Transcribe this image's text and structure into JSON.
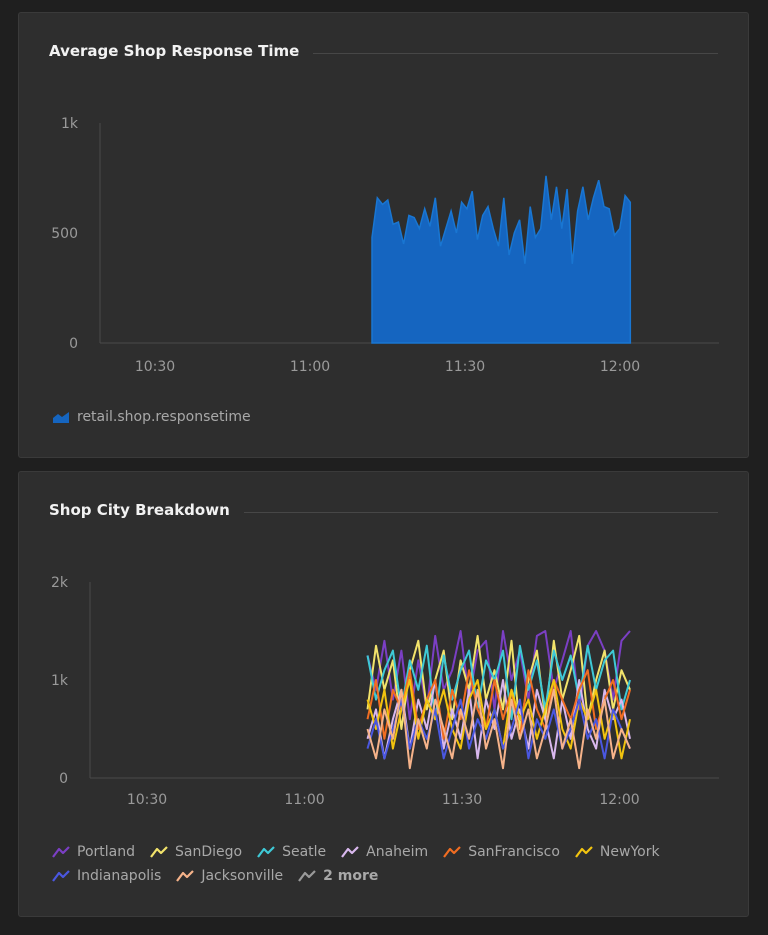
{
  "chart_data": [
    {
      "type": "area",
      "title": "Average Shop Response Time",
      "x_ticks": [
        "10:30",
        "11:00",
        "11:30",
        "12:00"
      ],
      "y_ticks": [
        "0",
        "500",
        "1k"
      ],
      "ylim": [
        0,
        1000
      ],
      "grid": false,
      "legend_placement": "bottom-left",
      "series": [
        {
          "name": "retail.shop.responsetime",
          "color": "#1565c0",
          "x_start": "11:12",
          "x_end": "12:02",
          "values": [
            480,
            660,
            630,
            650,
            540,
            550,
            450,
            580,
            570,
            520,
            610,
            530,
            660,
            440,
            520,
            600,
            500,
            640,
            610,
            690,
            470,
            580,
            620,
            520,
            440,
            660,
            400,
            500,
            560,
            360,
            620,
            480,
            520,
            760,
            560,
            710,
            520,
            700,
            360,
            600,
            710,
            560,
            660,
            740,
            620,
            610,
            490,
            520,
            670,
            640
          ]
        }
      ]
    },
    {
      "type": "line",
      "title": "Shop City Breakdown",
      "x_ticks": [
        "10:30",
        "11:00",
        "11:30",
        "12:00"
      ],
      "y_ticks": [
        "0",
        "1k",
        "2k"
      ],
      "ylim": [
        0,
        2000
      ],
      "grid": false,
      "legend_placement": "bottom-left",
      "x_start": "11:12",
      "x_end": "12:02",
      "series": [
        {
          "name": "Portland",
          "color": "#7b3fc4",
          "values": [
            1250,
            900,
            1400,
            800,
            1300,
            600,
            1200,
            700,
            1450,
            900,
            1100,
            1500,
            800,
            1300,
            1400,
            700,
            1500,
            1000,
            1300,
            800,
            1450,
            1500,
            900,
            1200,
            1500,
            700,
            1350,
            1500,
            1300,
            800,
            1400,
            1500
          ]
        },
        {
          "name": "SanDiego",
          "color": "#f2e36b",
          "values": [
            700,
            1350,
            900,
            1200,
            500,
            1100,
            1400,
            700,
            1000,
            1300,
            600,
            1200,
            900,
            1450,
            800,
            1100,
            700,
            1400,
            500,
            1000,
            1300,
            600,
            1400,
            800,
            1100,
            1450,
            600,
            1000,
            1300,
            700,
            1100,
            900
          ]
        },
        {
          "name": "Seatle",
          "color": "#3ec9d6",
          "values": [
            1250,
            800,
            1100,
            1300,
            700,
            1200,
            900,
            1350,
            600,
            1250,
            800,
            1100,
            1300,
            700,
            1200,
            1000,
            1300,
            600,
            1350,
            900,
            1200,
            700,
            1300,
            1000,
            1250,
            800,
            1350,
            900,
            1200,
            1300,
            700,
            1000
          ]
        },
        {
          "name": "Anaheim",
          "color": "#d9b8ee",
          "values": [
            400,
            700,
            200,
            600,
            900,
            300,
            800,
            500,
            1000,
            300,
            700,
            400,
            900,
            200,
            800,
            500,
            1000,
            400,
            700,
            300,
            900,
            600,
            200,
            800,
            400,
            1000,
            500,
            300,
            900,
            600,
            800,
            400
          ]
        },
        {
          "name": "SanFrancisco",
          "color": "#f06d22",
          "values": [
            600,
            1000,
            400,
            900,
            700,
            1100,
            500,
            800,
            1000,
            400,
            900,
            600,
            1100,
            700,
            500,
            1000,
            600,
            900,
            400,
            1100,
            700,
            500,
            1000,
            800,
            600,
            900,
            1100,
            500,
            800,
            1000,
            600,
            900
          ]
        },
        {
          "name": "NewYork",
          "color": "#f2c40f",
          "values": [
            800,
            500,
            900,
            300,
            700,
            1000,
            400,
            800,
            600,
            900,
            500,
            300,
            800,
            1000,
            500,
            700,
            300,
            900,
            600,
            800,
            400,
            700,
            1000,
            500,
            300,
            800,
            600,
            900,
            400,
            700,
            200,
            600
          ]
        },
        {
          "name": "Indianapolis",
          "color": "#4a57e0",
          "values": [
            300,
            600,
            200,
            500,
            800,
            300,
            600,
            400,
            700,
            200,
            500,
            800,
            300,
            600,
            400,
            700,
            300,
            500,
            800,
            200,
            600,
            400,
            700,
            300,
            500,
            800,
            400,
            600,
            200,
            700,
            500,
            300
          ]
        },
        {
          "name": "Jacksonville",
          "color": "#f6b38a",
          "values": [
            500,
            200,
            700,
            400,
            900,
            100,
            600,
            300,
            800,
            500,
            200,
            700,
            400,
            900,
            300,
            600,
            100,
            800,
            400,
            700,
            200,
            500,
            900,
            300,
            600,
            100,
            700,
            400,
            800,
            200,
            500,
            300
          ]
        }
      ],
      "hidden_series_label": "2 more"
    }
  ]
}
